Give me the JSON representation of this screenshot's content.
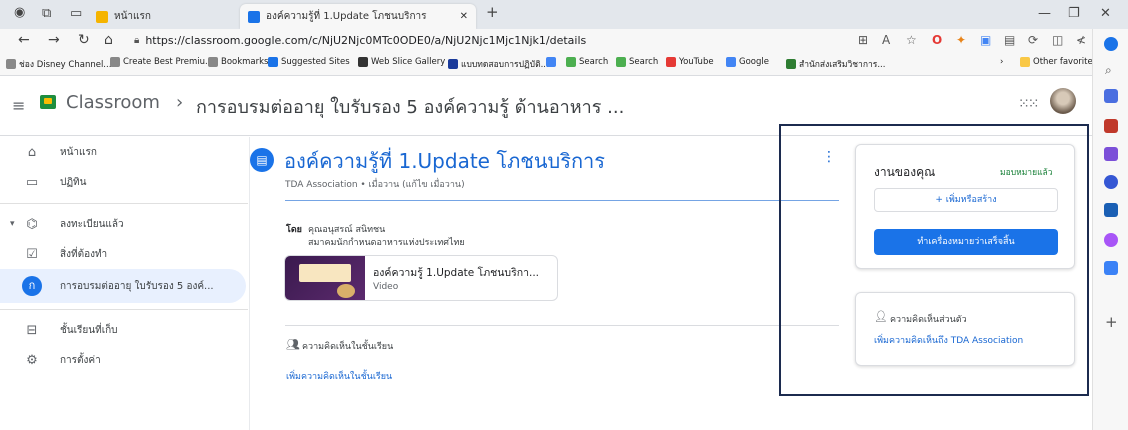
{
  "browser": {
    "tabs": [
      {
        "label": "หน้าแรก",
        "favicon_color": "#f5b400"
      },
      {
        "label": "องค์ความรู้ที่ 1.Update โภชนบริการ",
        "favicon_color": "#1a73e8"
      }
    ],
    "new_tab": "+",
    "window_controls": {
      "minimize": "—",
      "restore": "❐",
      "close": "✕"
    },
    "url": "https://classroom.google.com/c/NjU2Njc0MTc0ODE0/a/NjU2Njc1Mjc1Njk1/details",
    "bookmarks": [
      "ช่อง Disney Channel...",
      "Create Best Premiu...",
      "Bookmarks",
      "Suggested Sites",
      "Web Slice Gallery",
      "แบบทดสอบการปฏิบัติ...",
      "Search",
      "Search",
      "YouTube",
      "Google",
      "สำนักส่งเสริมวิชาการ..."
    ],
    "other_favorites": "Other favorites"
  },
  "header": {
    "brand": "Classroom",
    "separator": "›",
    "course_title": "การอบรมต่ออายุ ใบรับรอง 5 องค์ความรู้ ด้านอาหาร ..."
  },
  "sidebar": {
    "items": [
      {
        "label": "หน้าแรก",
        "icon": "home-icon"
      },
      {
        "label": "ปฏิทิน",
        "icon": "calendar-icon"
      },
      {
        "label": "ลงทะเบียนแล้ว",
        "icon": "enrolled-icon"
      },
      {
        "label": "สิ่งที่ต้องทำ",
        "icon": "todo-icon"
      },
      {
        "label": "การอบรมต่ออายุ ใบรับรอง 5 องค์...",
        "icon": "course-badge",
        "badge": "ก"
      },
      {
        "label": "ชั้นเรียนที่เก็บ",
        "icon": "archive-icon"
      },
      {
        "label": "การตั้งค่า",
        "icon": "settings-icon"
      }
    ]
  },
  "post": {
    "title": "องค์ความรู้ที่ 1.Update โภชนบริการ",
    "meta": "TDA Association • เมื่อวาน (แก้ไข เมื่อวาน)",
    "by_label": "โดย",
    "author": "คุณอนุสรณ์ สนิทชน",
    "organization": "สมาคมนักกำหนดอาหารแห่งประเทศไทย",
    "attachment": {
      "title": "องค์ความรู้ 1.Update โภชนบริกา...",
      "type": "Video"
    },
    "class_comments_label": "ความคิดเห็นในชั้นเรียน",
    "add_class_comment": "เพิ่มความคิดเห็นในชั้นเรียน"
  },
  "work": {
    "title": "งานของคุณ",
    "status": "มอบหมายแล้ว",
    "add_button": "+ เพิ่มหรือสร้าง",
    "done_button": "ทำเครื่องหมายว่าเสร็จสิ้น"
  },
  "private_comments": {
    "title": "ความคิดเห็นส่วนตัว",
    "add_link": "เพิ่มความคิดเห็นถึง TDA Association"
  }
}
